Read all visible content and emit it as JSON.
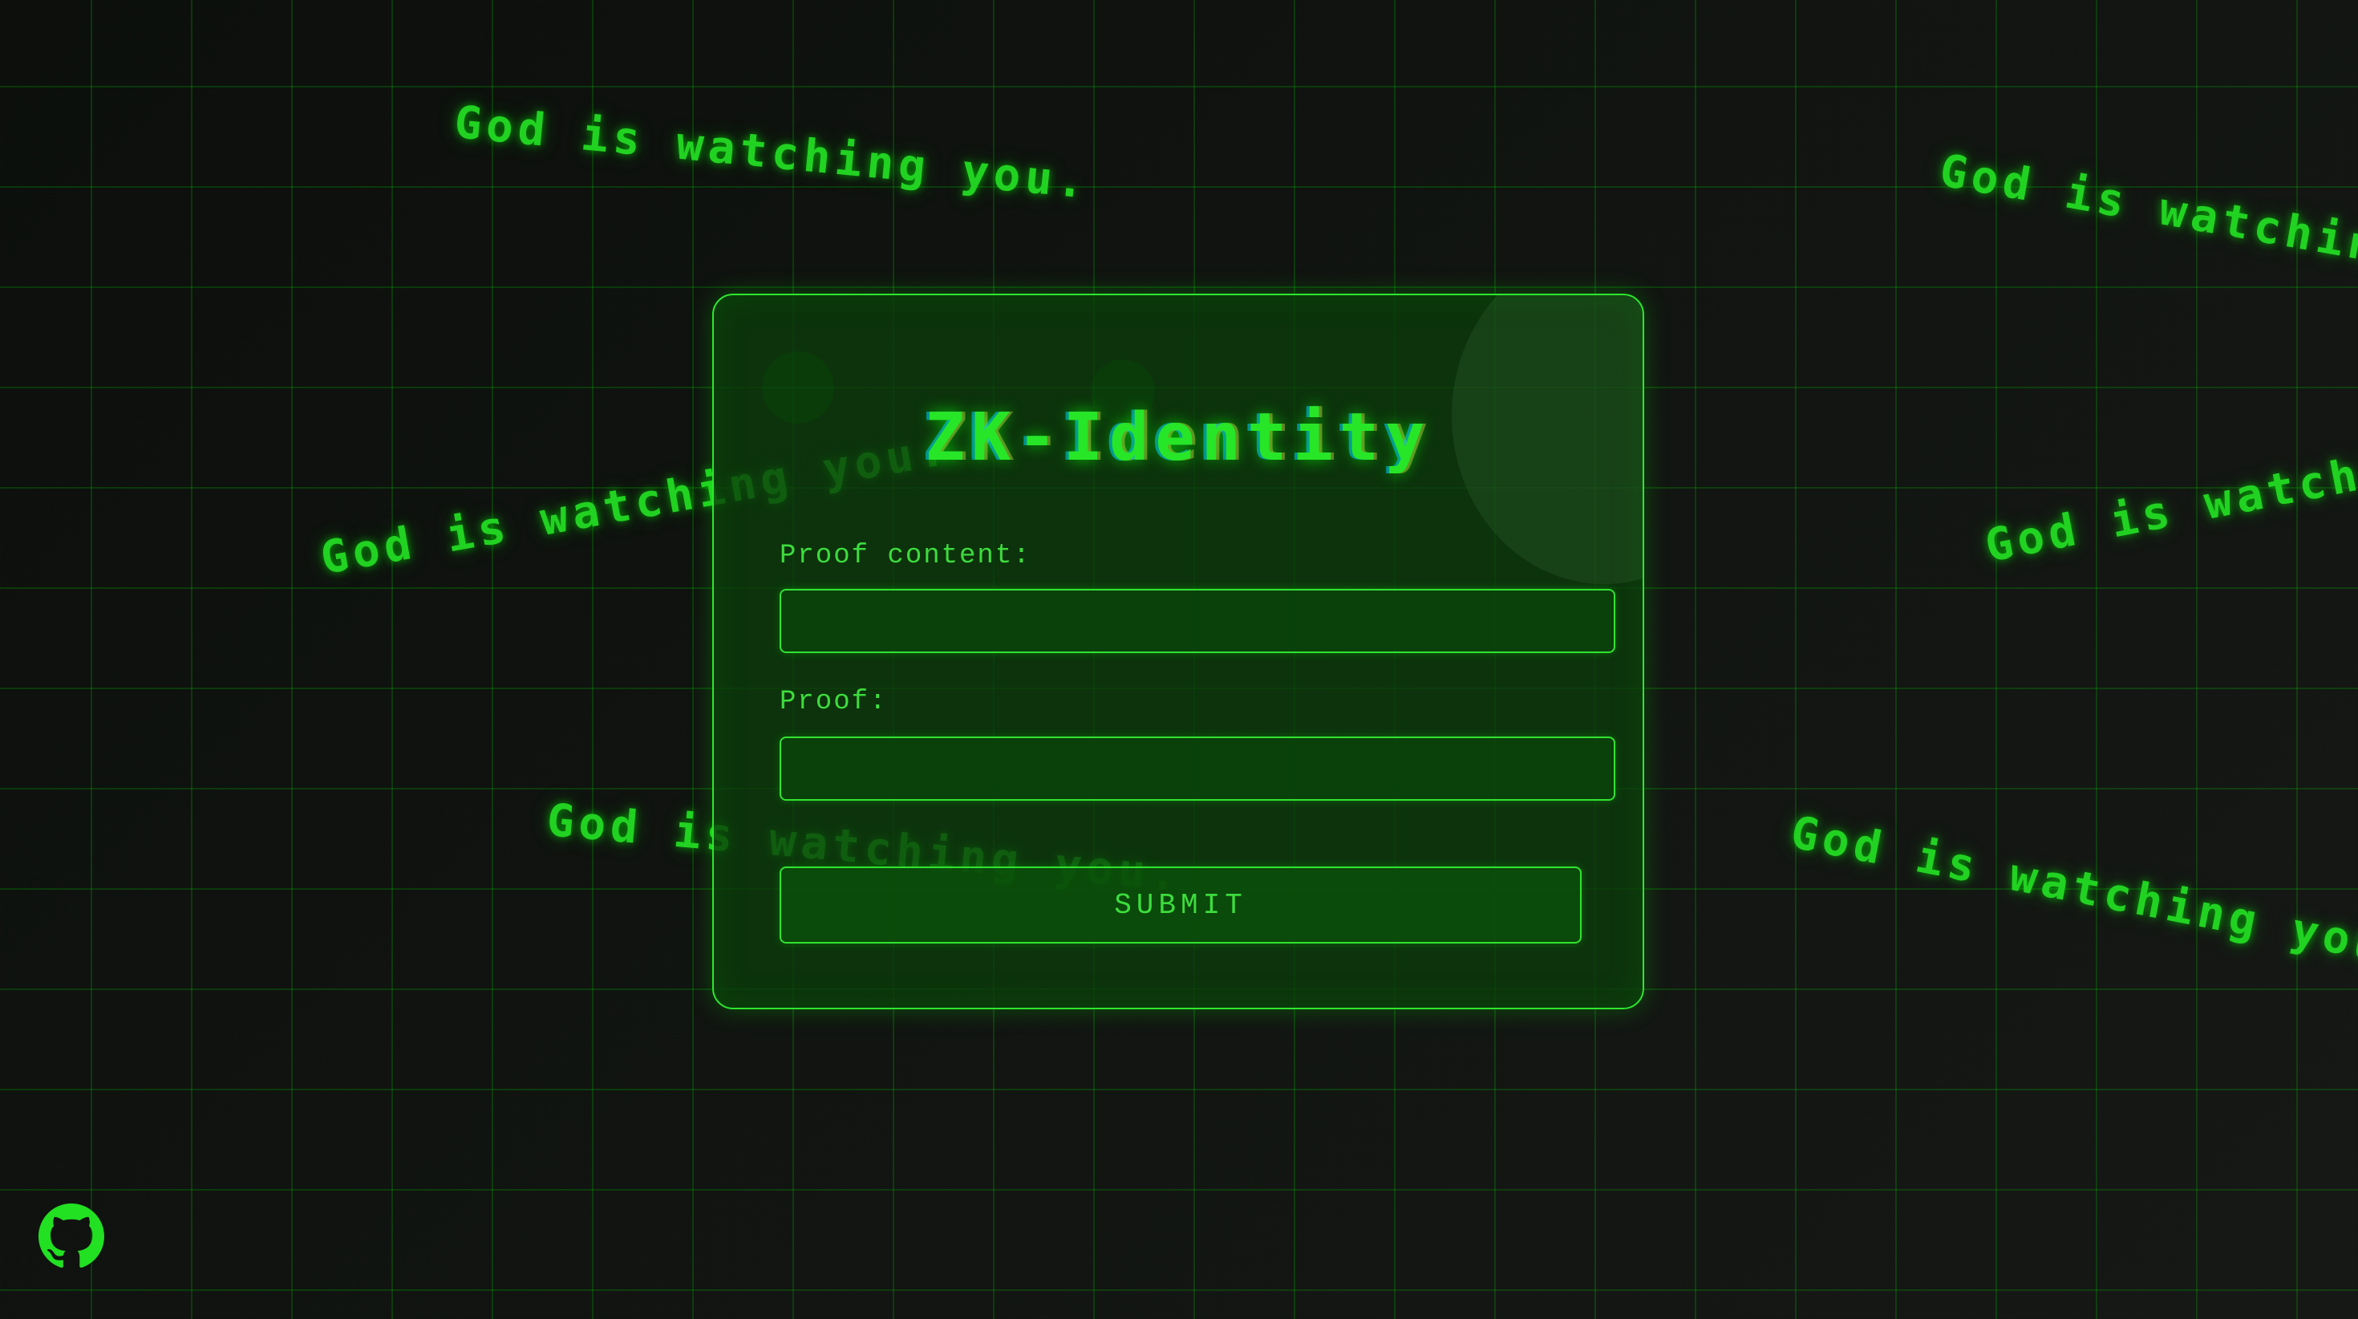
{
  "app": {
    "title": "ZK-Identity"
  },
  "background": {
    "watermark_text": "God is watching you."
  },
  "form": {
    "proof_content_label": "Proof content:",
    "proof_content_value": "",
    "proof_label": "Proof:",
    "proof_value": "",
    "submit_label": "SUBMIT"
  },
  "footer": {
    "github_icon": "github-icon"
  },
  "colors": {
    "accent": "#22d222",
    "background": "#0d0f0d",
    "card_border": "#2ee62e"
  }
}
